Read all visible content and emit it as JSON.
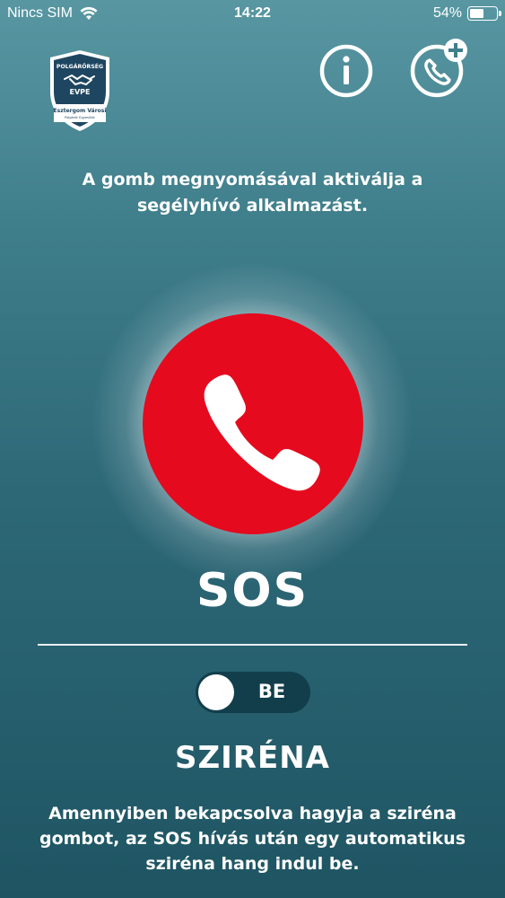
{
  "status_bar": {
    "carrier": "Nincs SIM",
    "time": "14:22",
    "battery": "54%",
    "battery_level": 0.54,
    "wifi_icon": "wifi-icon"
  },
  "header": {
    "logo": {
      "top_text": "POLGÁRŐRSÉG",
      "name": "EVPE",
      "line1": "Esztergom Városi",
      "line2": "Polgárőr Egyesület"
    },
    "info_icon": "info-icon",
    "add_contact_icon": "phone-plus-icon"
  },
  "intro_text": "A gomb megnyomásával aktiválja a segélyhívó alkalmazást.",
  "sos": {
    "icon": "phone-icon",
    "label": "SOS",
    "button_color": "#e50a1e"
  },
  "siren": {
    "toggle_label": "BE",
    "toggle_on": true,
    "title": "SZIRÉNA",
    "description": "Amennyiben bekapcsolva hagyja a sziréna gombot, az SOS hívás után egy automatikus sziréna hang indul be."
  },
  "colors": {
    "background_top": "#5897a2",
    "background_bottom": "#1f5563",
    "toggle_bg": "#123e4b",
    "logo_badge": "#1e4660"
  }
}
